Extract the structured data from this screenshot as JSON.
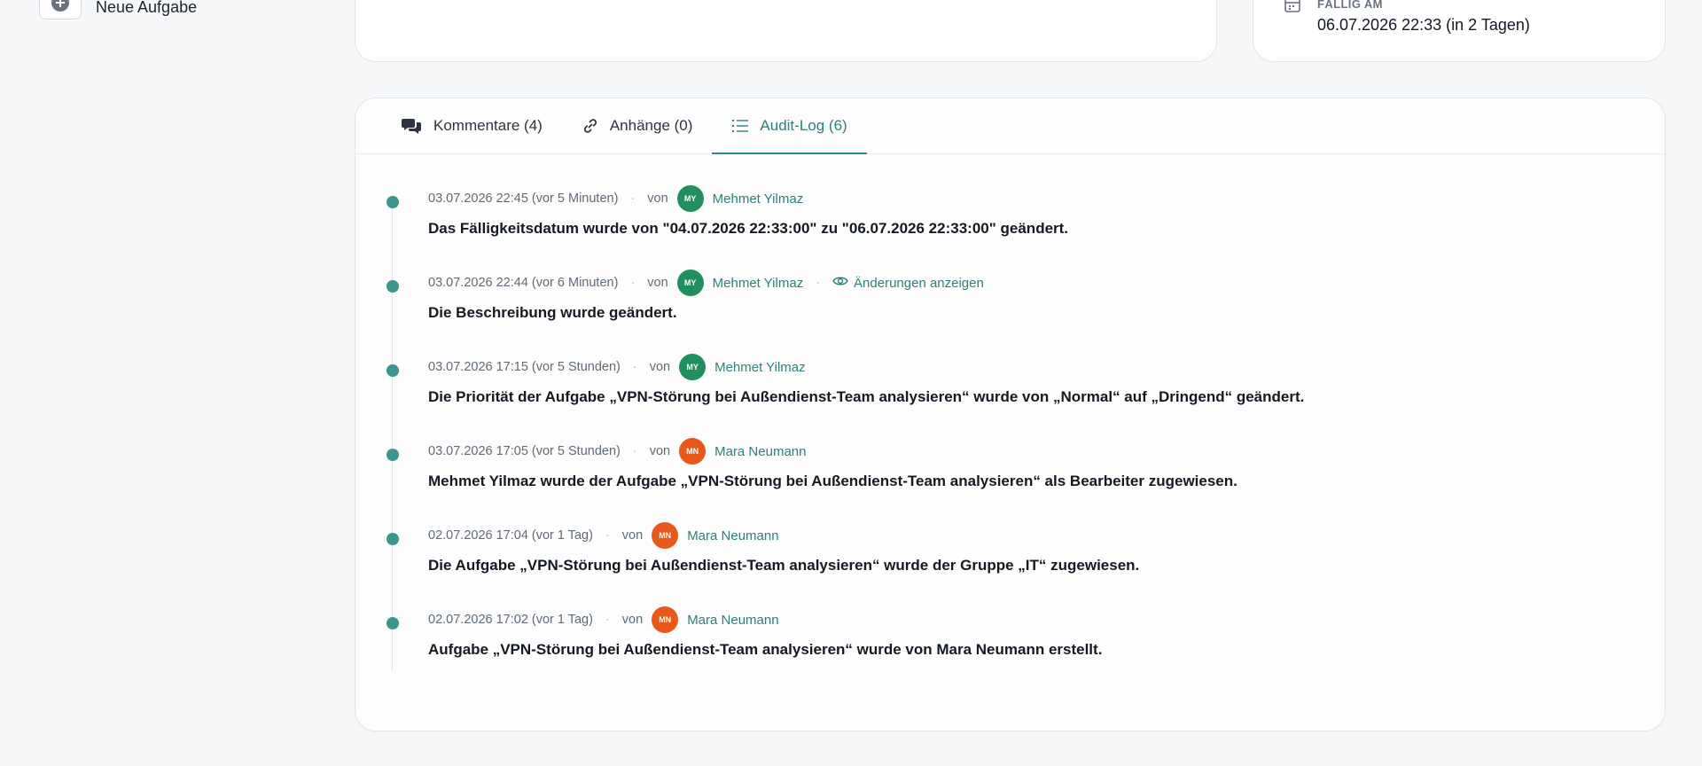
{
  "sidebar": {
    "new_task_label": "Neue Aufgabe"
  },
  "due": {
    "label": "Fällig am",
    "value": "06.07.2026 22:33 (in 2 Tagen)"
  },
  "tabs": [
    {
      "label": "Kommentare (4)",
      "icon": "comments-icon",
      "active": false
    },
    {
      "label": "Anhänge (0)",
      "icon": "link-icon",
      "active": false
    },
    {
      "label": "Audit-Log (6)",
      "icon": "list-icon",
      "active": true
    }
  ],
  "audit": {
    "von_label": "von",
    "changes_label": "Änderungen anzeigen",
    "entries": [
      {
        "timestamp": "03.07.2026 22:45 (vor 5 Minuten)",
        "initials": "MY",
        "author": "Mehmet Yilmaz",
        "avatar_color": "#1f8f5f",
        "message": "Das Fälligkeitsdatum wurde von \"04.07.2026 22:33:00\" zu \"06.07.2026 22:33:00\" geändert."
      },
      {
        "timestamp": "03.07.2026 22:44 (vor 6 Minuten)",
        "initials": "MY",
        "author": "Mehmet Yilmaz",
        "avatar_color": "#1f8f5f",
        "message": "Die Beschreibung wurde geändert.",
        "has_changes_link": true
      },
      {
        "timestamp": "03.07.2026 17:15 (vor 5 Stunden)",
        "initials": "MY",
        "author": "Mehmet Yilmaz",
        "avatar_color": "#1f8f5f",
        "message": "Die Priorität der Aufgabe „VPN-Störung bei Außendienst-Team analysieren“ wurde von „Normal“ auf „Dringend“ geändert."
      },
      {
        "timestamp": "03.07.2026 17:05 (vor 5 Stunden)",
        "initials": "MN",
        "author": "Mara Neumann",
        "avatar_color": "#e8581b",
        "message": "Mehmet Yilmaz wurde der Aufgabe „VPN-Störung bei Außendienst-Team analysieren“ als Bearbeiter zugewiesen."
      },
      {
        "timestamp": "02.07.2026 17:04 (vor 1 Tag)",
        "initials": "MN",
        "author": "Mara Neumann",
        "avatar_color": "#e8581b",
        "message": "Die Aufgabe „VPN-Störung bei Außendienst-Team analysieren“ wurde der Gruppe „IT“ zugewiesen."
      },
      {
        "timestamp": "02.07.2026 17:02 (vor 1 Tag)",
        "initials": "MN",
        "author": "Mara Neumann",
        "avatar_color": "#e8581b",
        "message": "Aufgabe „VPN-Störung bei Außendienst-Team analysieren“ wurde von Mara Neumann erstellt."
      }
    ]
  },
  "colors": {
    "accent": "#2f807a",
    "timeline_dot": "#3d958f"
  }
}
